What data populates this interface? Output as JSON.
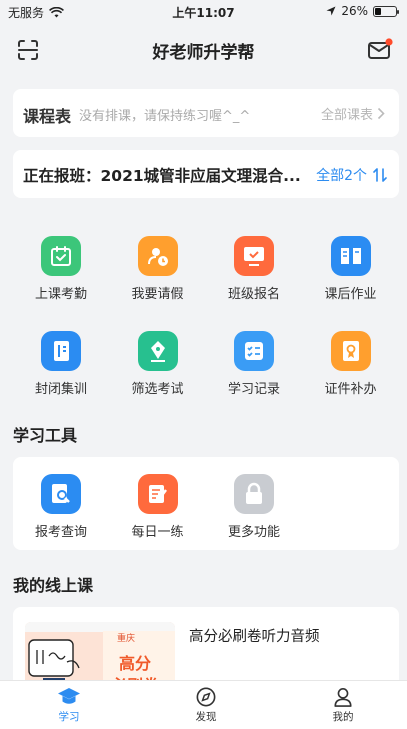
{
  "status_bar": {
    "carrier": "无服务",
    "time": "上午11:07",
    "battery": "26%",
    "battery_level": 0.26
  },
  "header": {
    "title": "好老师升学帮"
  },
  "schedule": {
    "title": "课程表",
    "empty_text": "没有排课，请保持练习喔^_^",
    "all_label": "全部课表"
  },
  "enrolled": {
    "text": "正在报班：2021城管非应届文理混合...",
    "all_label": "全部2个"
  },
  "quick_actions": [
    {
      "label": "上课考勤",
      "icon": "calendar-check-icon",
      "color": "#3cc67a"
    },
    {
      "label": "我要请假",
      "icon": "person-clock-icon",
      "color": "#ff9f2e"
    },
    {
      "label": "班级报名",
      "icon": "monitor-check-icon",
      "color": "#ff6a3d"
    },
    {
      "label": "课后作业",
      "icon": "book-icon",
      "color": "#2b8cf2"
    },
    {
      "label": "封闭集训",
      "icon": "notebook-icon",
      "color": "#2b8cf2"
    },
    {
      "label": "筛选考试",
      "icon": "pen-nib-icon",
      "color": "#27c08f"
    },
    {
      "label": "学习记录",
      "icon": "checklist-icon",
      "color": "#3a9cf5"
    },
    {
      "label": "证件补办",
      "icon": "certificate-icon",
      "color": "#ff9f2e"
    }
  ],
  "tools": {
    "title": "学习工具",
    "items": [
      {
        "label": "报考查询",
        "icon": "search-doc-icon",
        "color": "#2b8cf2"
      },
      {
        "label": "每日一练",
        "icon": "edit-note-icon",
        "color": "#ff6a3d"
      },
      {
        "label": "更多功能",
        "icon": "lock-icon",
        "color": "#c9ccd1"
      }
    ]
  },
  "online": {
    "title": "我的线上课",
    "course_title": "高分必刷卷听力音频",
    "thumb_tag": "重庆",
    "thumb_line1": "高分",
    "thumb_line2": "必刷卷"
  },
  "tabbar": [
    {
      "label": "学习",
      "icon": "graduation-cap-icon"
    },
    {
      "label": "发现",
      "icon": "compass-icon"
    },
    {
      "label": "我的",
      "icon": "user-icon"
    }
  ]
}
